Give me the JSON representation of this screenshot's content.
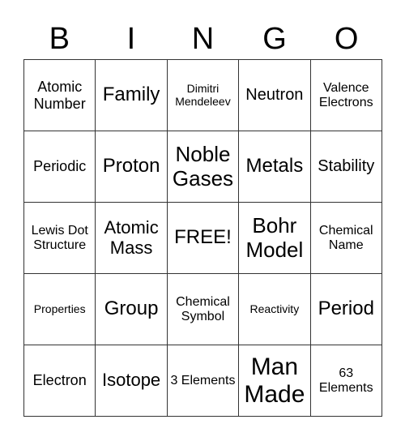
{
  "header": {
    "letters": [
      "B",
      "I",
      "N",
      "G",
      "O"
    ]
  },
  "cells": [
    [
      "Atomic Number",
      "Family",
      "Dimitri Mendeleev",
      "Neutron",
      "Valence Electrons"
    ],
    [
      "Periodic",
      "Proton",
      "Noble Gases",
      "Metals",
      "Stability"
    ],
    [
      "Lewis Dot Structure",
      "Atomic Mass",
      "FREE!",
      "Bohr Model",
      "Chemical Name"
    ],
    [
      "Properties",
      "Group",
      "Chemical Symbol",
      "Reactivity",
      "Period"
    ],
    [
      "Electron",
      "Isotope",
      "3 Elements",
      "Man Made",
      "63 Elements"
    ]
  ]
}
